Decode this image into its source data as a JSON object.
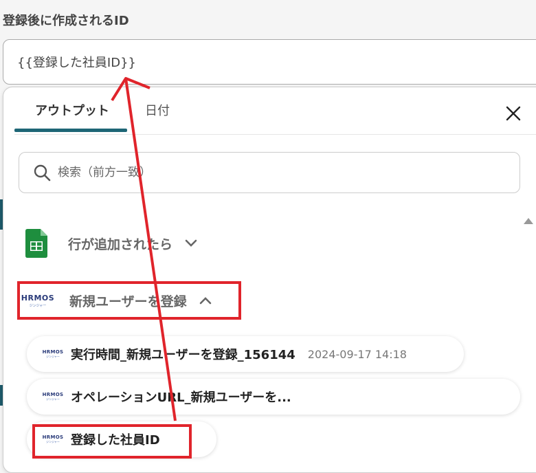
{
  "field": {
    "label": "登録後に作成されるID",
    "value": "{{登録した社員ID}}"
  },
  "popup": {
    "tabs": [
      {
        "label": "アウトプット",
        "active": true
      },
      {
        "label": "日付",
        "active": false
      }
    ],
    "search": {
      "placeholder": "検索（前方一致）"
    },
    "groups": [
      {
        "label": "行が追加されたら",
        "icon": "google-sheets-icon",
        "expanded": false
      },
      {
        "label": "新規ユーザーを登録",
        "icon": "hrmos-logo",
        "expanded": true
      }
    ],
    "items": [
      {
        "label": "実行時間_新規ユーザーを登録_156144",
        "value": "2024-09-17 14:18"
      },
      {
        "label": "オペレーションURL_新規ユーザーを..."
      },
      {
        "label": "登録した社員ID"
      }
    ]
  },
  "logo": {
    "text": "HRMOS",
    "subtext": "ジンジャー"
  },
  "colors": {
    "accent": "#1e6676",
    "highlight": "#e0242b",
    "sheets_green": "#1e8e3e"
  }
}
